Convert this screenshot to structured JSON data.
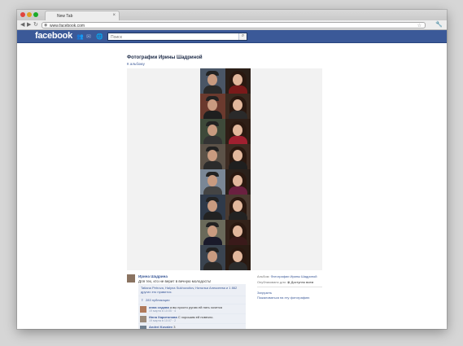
{
  "browser": {
    "tab_title": "New Tab",
    "tab_close": "×",
    "url": "www.facebook.com",
    "back": "◀",
    "forward": "▶",
    "reload": "↻",
    "star": "☆",
    "wrench": "🔧"
  },
  "facebook": {
    "logo": "facebook",
    "search_placeholder": "Поиск",
    "search_button": "⌕"
  },
  "album": {
    "title": "Фотографии Ирины Шадриной",
    "back_link": "К альбому"
  },
  "post": {
    "author": "Ирина Шадрина",
    "caption": "Для тех, кто не верит в вечную молодость!",
    "like_text": "Tatiana Petrova, Halyna Sukhovoitov, Наталья Алексеева и 1 862 других это нравится.",
    "shares": "283 публикации",
    "comments": [
      {
        "author": "инна седова",
        "text": "а вы просто ругаю ей пять хочется",
        "meta": "19 марта в 10:05 · 4",
        "avatar_color": "#b07a5b"
      },
      {
        "author": "Инна Харитонова",
        "text": "С хорошим ей повезло.",
        "meta": "19 марта в 10:07 · 2",
        "avatar_color": "#9a8a7a"
      },
      {
        "author": "Andrei Kovalev",
        "text": "3",
        "meta": "",
        "avatar_color": "#6f7f8f"
      }
    ]
  },
  "sidebar": {
    "album_label": "Альбом:",
    "album_name": "Фотографии Ирины Шадриной",
    "published_label": "Опубликовано для:",
    "audience": "Доступно всем",
    "download": "Загрузить",
    "report": "Пожаловаться на эту фотографию"
  },
  "colors": {
    "fb_blue": "#3b5998",
    "link": "#3b5998"
  }
}
